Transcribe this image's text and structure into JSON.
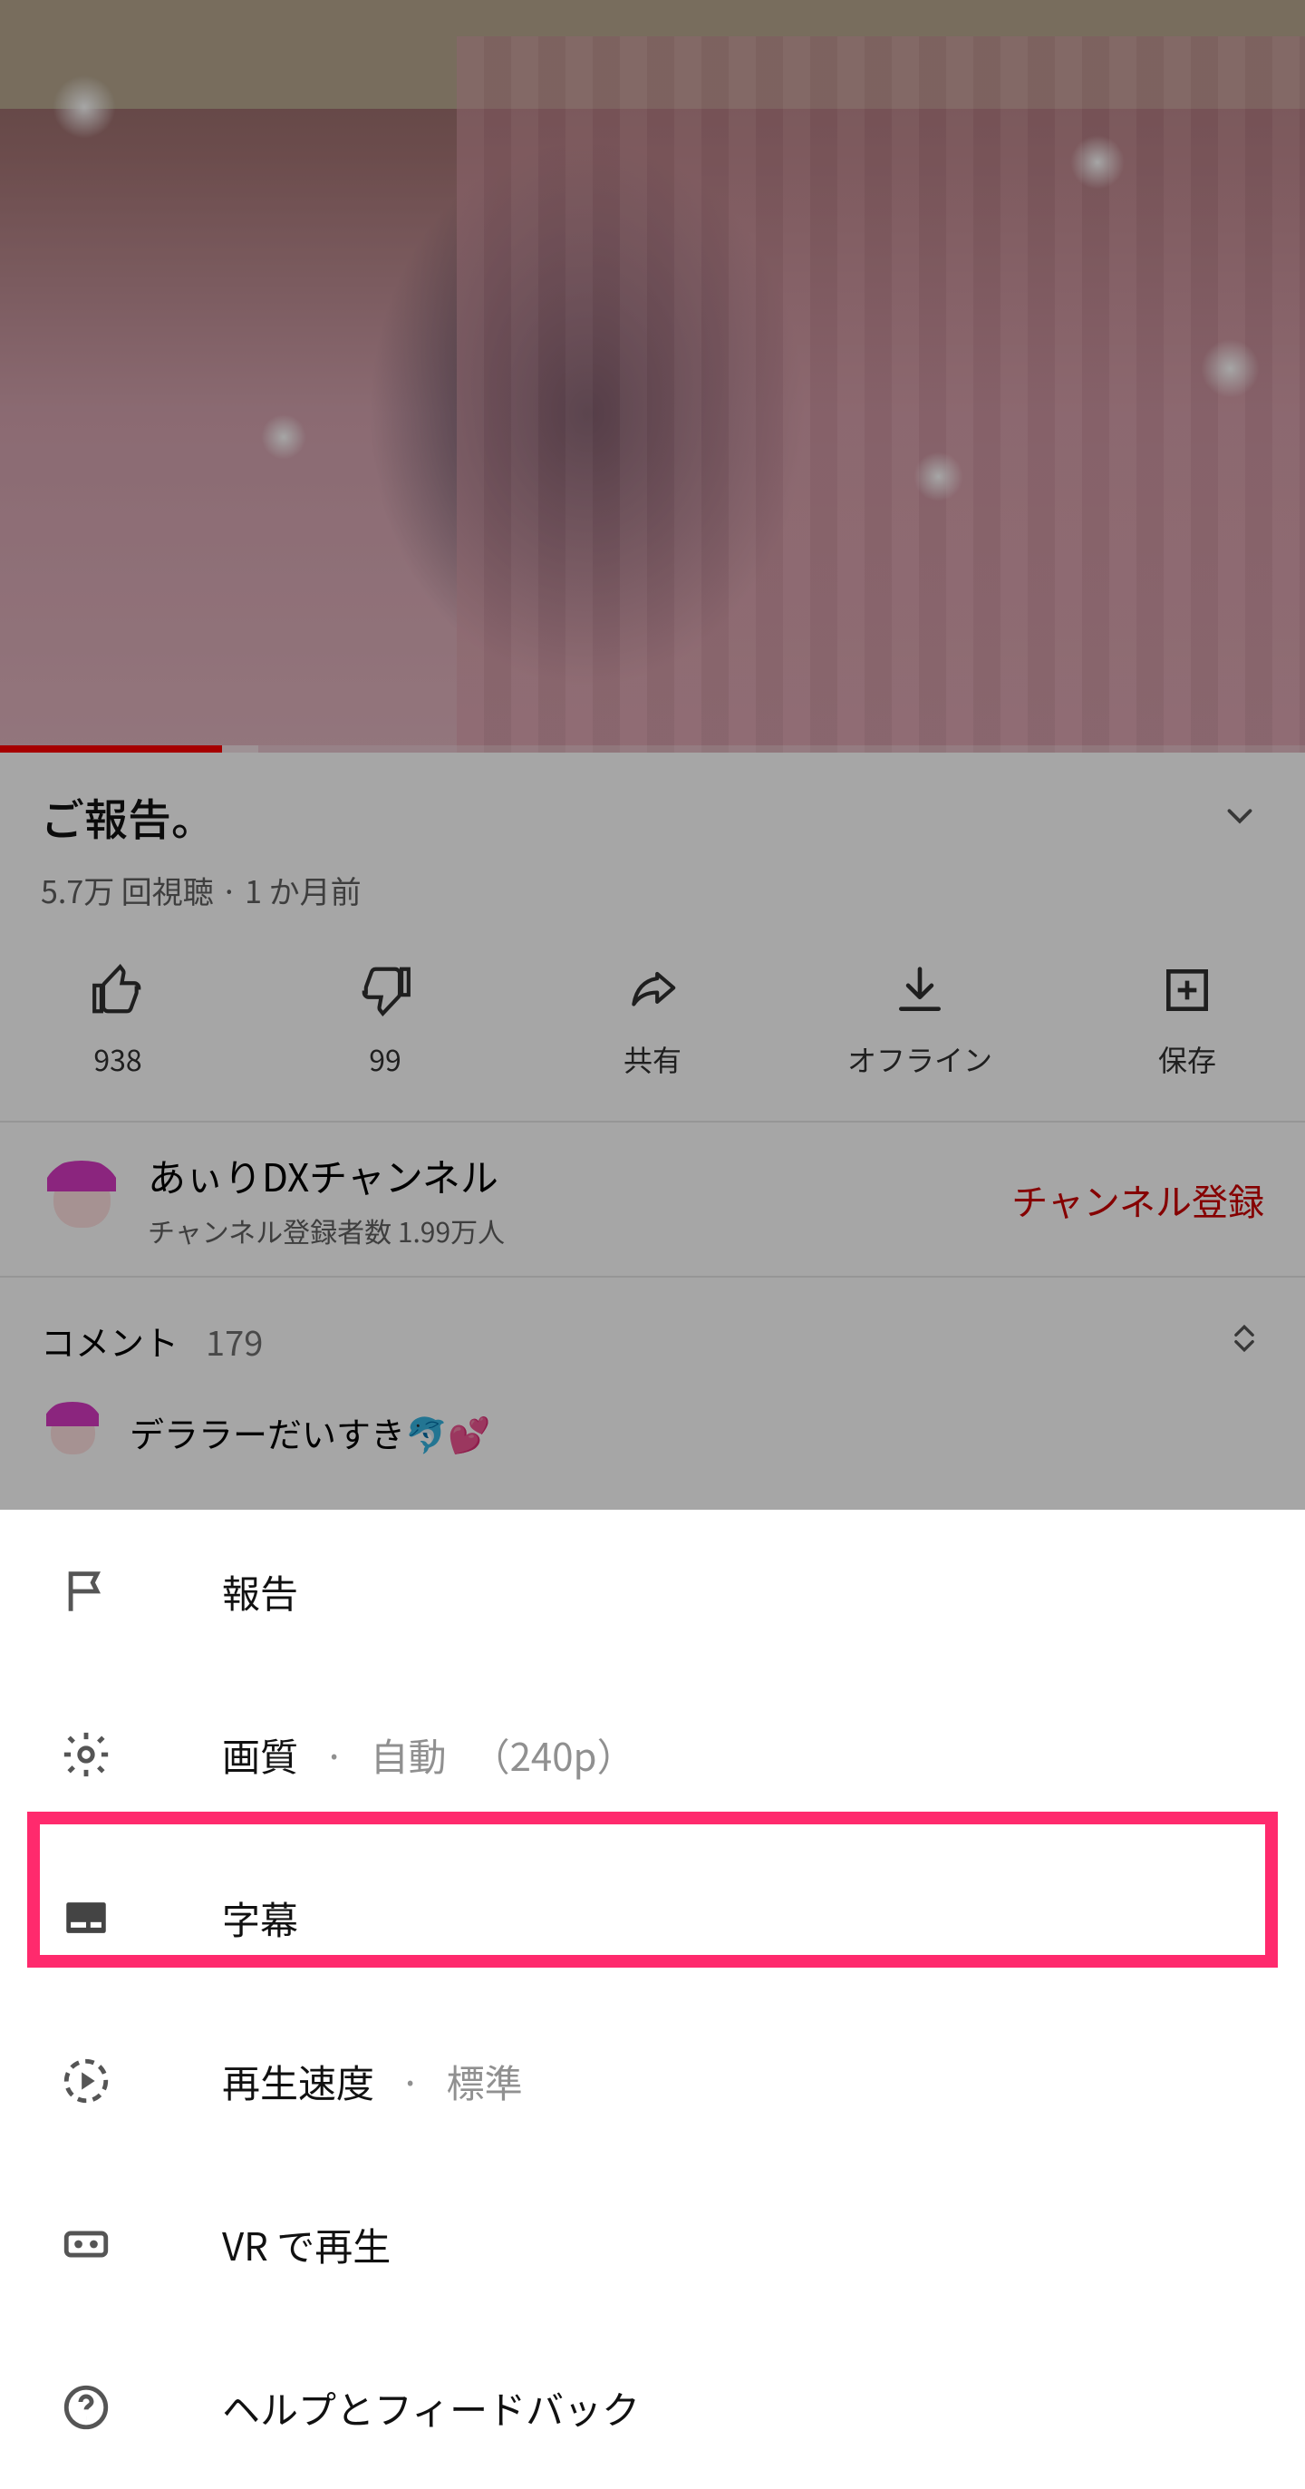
{
  "video": {
    "title": "ご報告。",
    "views": "5.7万 回視聴",
    "age": "1 か月前",
    "progress_percent": 17
  },
  "actions": {
    "like_count": "938",
    "dislike_count": "99",
    "share_label": "共有",
    "download_label": "オフライン",
    "save_label": "保存"
  },
  "channel": {
    "name": "あぃりDXチャンネル",
    "subscribers": "チャンネル登録者数 1.99万人",
    "subscribe_label": "チャンネル登録"
  },
  "comments": {
    "label": "コメント",
    "count": "179",
    "preview": "デララーだいすき🐬💕"
  },
  "menu": {
    "report": "報告",
    "quality": "画質",
    "quality_value_auto": "自動",
    "quality_value_res": "（240p）",
    "captions": "字幕",
    "speed": "再生速度",
    "speed_value": "標準",
    "vr": "VR で再生",
    "help": "ヘルプとフィードバック"
  }
}
